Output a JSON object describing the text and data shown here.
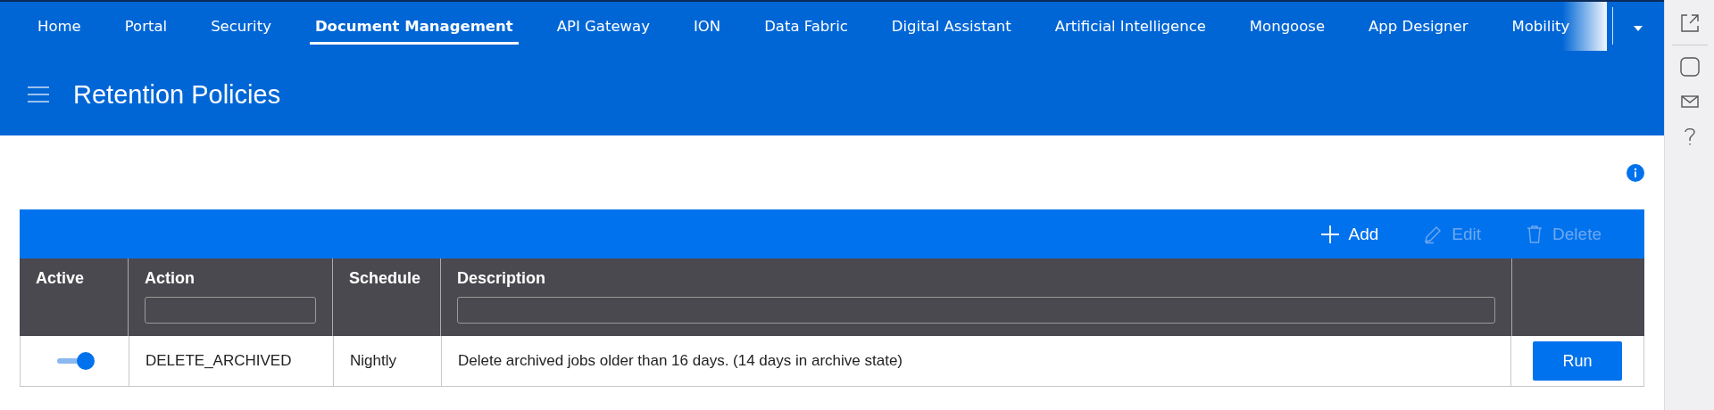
{
  "nav_tabs": [
    {
      "label": "Home",
      "selected": false
    },
    {
      "label": "Portal",
      "selected": false
    },
    {
      "label": "Security",
      "selected": false
    },
    {
      "label": "Document Management",
      "selected": true
    },
    {
      "label": "API Gateway",
      "selected": false
    },
    {
      "label": "ION",
      "selected": false
    },
    {
      "label": "Data Fabric",
      "selected": false
    },
    {
      "label": "Digital Assistant",
      "selected": false
    },
    {
      "label": "Artificial Intelligence",
      "selected": false
    },
    {
      "label": "Mongoose",
      "selected": false
    },
    {
      "label": "App Designer",
      "selected": false
    },
    {
      "label": "Mobility",
      "selected": false
    }
  ],
  "page_title": "Retention Policies",
  "toolbar": [
    {
      "kind": "add",
      "label": "Add",
      "disabled": false
    },
    {
      "kind": "edit",
      "label": "Edit",
      "disabled": true
    },
    {
      "kind": "delete",
      "label": "Delete",
      "disabled": true
    }
  ],
  "table": {
    "columns": [
      {
        "label": "Active",
        "filter": false
      },
      {
        "label": "Action",
        "filter": true
      },
      {
        "label": "Schedule",
        "filter": false
      },
      {
        "label": "Description",
        "filter": true
      }
    ],
    "rows": [
      {
        "active": true,
        "action": "DELETE_ARCHIVED",
        "schedule": "Nightly",
        "description": "Delete archived jobs older than 16 days. (14 days in archive state)",
        "button": "Run"
      }
    ]
  }
}
